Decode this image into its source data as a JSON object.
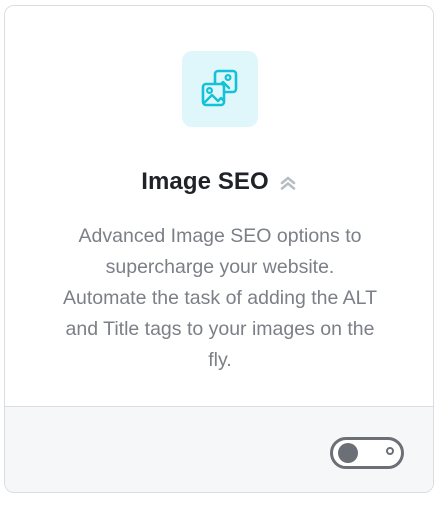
{
  "module": {
    "title": "Image SEO",
    "description_lines": [
      "Advanced Image SEO options to",
      "supercharge your website.",
      "Automate the task of adding the ALT",
      "and Title tags to your images on the",
      "fly."
    ],
    "icon": "images-icon",
    "badge_icon": "pro-chevrons-icon",
    "enabled": false
  },
  "colors": {
    "icon_tile_bg": "#dff6fb",
    "icon_stroke": "#13c2d6",
    "toggle": "#6b6f76",
    "footer_bg": "#f6f7f9"
  }
}
